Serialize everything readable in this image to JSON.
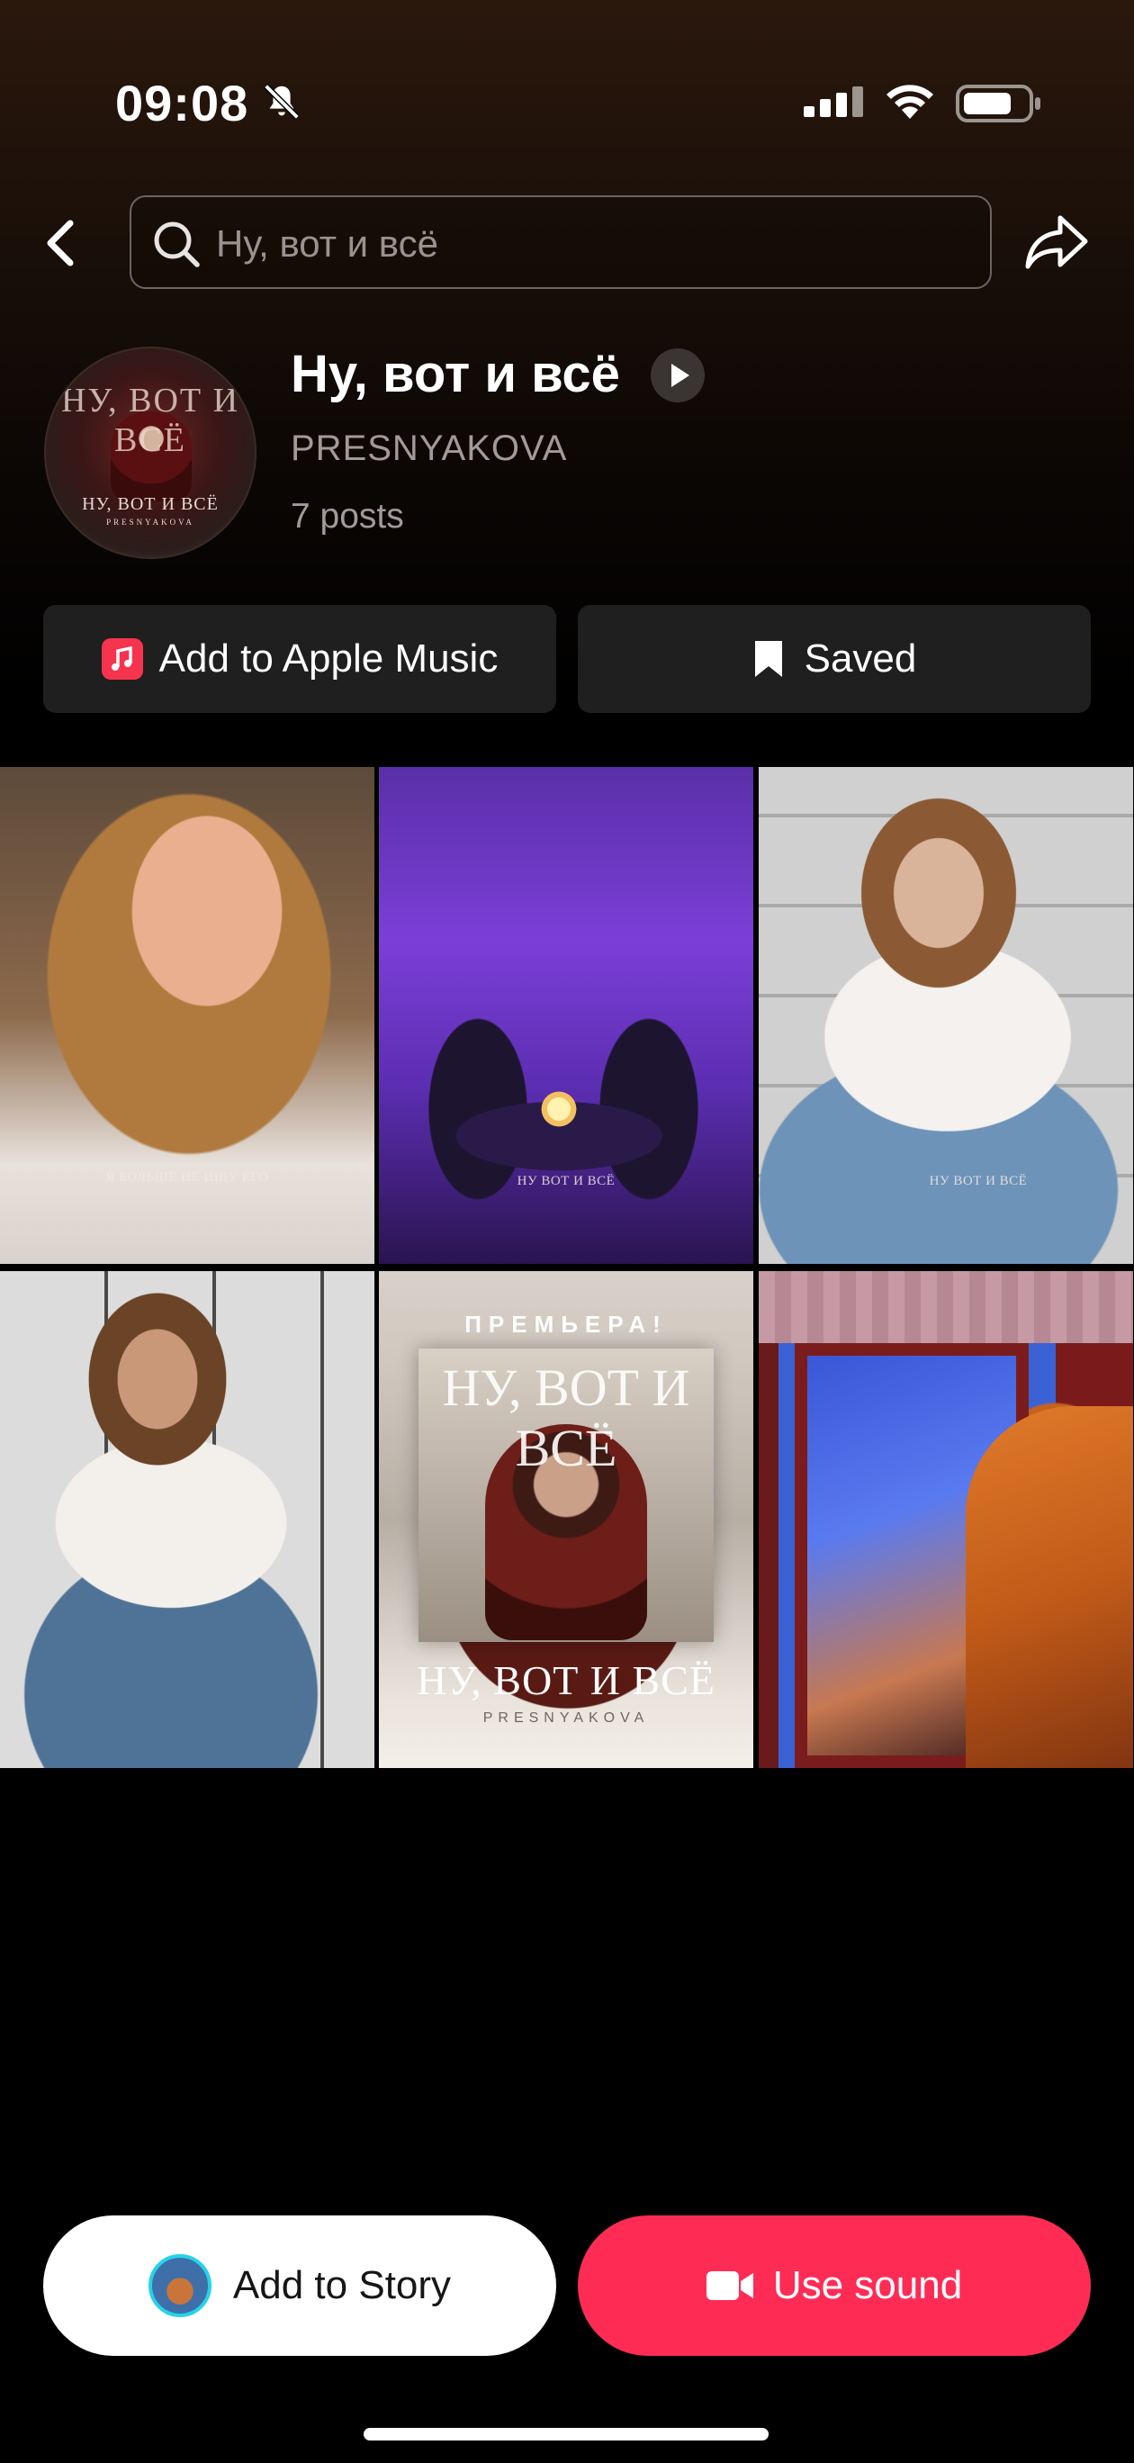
{
  "status_bar": {
    "time": "09:08",
    "icons": [
      "bell-slash-icon",
      "signal-icon",
      "wifi-icon",
      "battery-icon"
    ]
  },
  "header": {
    "search_placeholder": "Ну, вот и всё",
    "icons": [
      "back-chevron-icon",
      "search-icon",
      "share-icon"
    ]
  },
  "sound": {
    "title": "Ну, вот и всё",
    "artist": "PRESNYAKOVA",
    "posts": "7 posts",
    "cover_text": "НУ, ВОТ И ВСЁ"
  },
  "actions": {
    "apple_music_label": "Add to Apple Music",
    "saved_label": "Saved"
  },
  "grid": [
    {
      "caption": "Я БОЛЬШЕ НЕ ИЩУ ЕГО"
    },
    {
      "caption": "НУ ВОТ И ВСЁ"
    },
    {
      "caption": "НУ ВОТ И ВСЁ"
    },
    {
      "caption": ""
    },
    {
      "premiere": "ПРЕМЬЕРА!",
      "poster_title": "НУ, ВОТ И ВСЁ",
      "poster_artist": "PRESNYAKOVA"
    },
    {
      "caption": ""
    }
  ],
  "bottom": {
    "story_label": "Add to Story",
    "use_label": "Use sound"
  },
  "colors": {
    "accent": "#fe2c55",
    "apple_music": "#f6344e",
    "button_bg": "#1f1f1f"
  }
}
